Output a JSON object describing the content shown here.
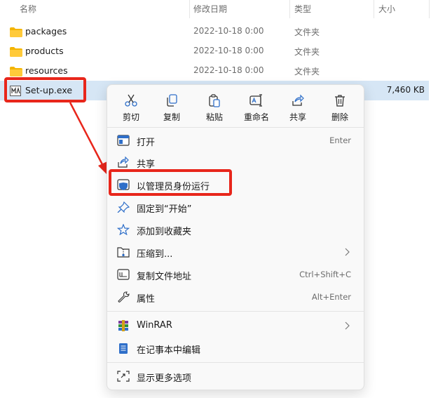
{
  "columns": {
    "name": "名称",
    "date": "修改日期",
    "type": "类型",
    "size": "大小"
  },
  "files": [
    {
      "name": "packages",
      "date": "2022-10-18 0:00",
      "type": "文件夹",
      "size": ""
    },
    {
      "name": "products",
      "date": "2022-10-18 0:00",
      "type": "文件夹",
      "size": ""
    },
    {
      "name": "resources",
      "date": "2022-10-18 0:00",
      "type": "文件夹",
      "size": ""
    },
    {
      "name": "Set-up.exe",
      "date": "",
      "type": "",
      "size": "7,460 KB"
    }
  ],
  "context_menu": {
    "quick_actions": [
      {
        "label": "剪切",
        "icon": "scissors-icon"
      },
      {
        "label": "复制",
        "icon": "copy-icon"
      },
      {
        "label": "粘贴",
        "icon": "paste-icon"
      },
      {
        "label": "重命名",
        "icon": "rename-icon"
      },
      {
        "label": "共享",
        "icon": "share-icon"
      },
      {
        "label": "删除",
        "icon": "trash-icon"
      }
    ],
    "items": [
      {
        "label": "打开",
        "shortcut": "Enter",
        "icon": "open-window-icon"
      },
      {
        "label": "共享",
        "shortcut": "",
        "icon": "share-icon"
      },
      {
        "label": "以管理员身份运行",
        "shortcut": "",
        "icon": "shield-icon"
      },
      {
        "label": "固定到“开始”",
        "shortcut": "",
        "icon": "pin-icon"
      },
      {
        "label": "添加到收藏夹",
        "shortcut": "",
        "icon": "star-icon"
      },
      {
        "label": "压缩到...",
        "shortcut": "",
        "icon": "zip-folder-icon"
      },
      {
        "label": "复制文件地址",
        "shortcut": "Ctrl+Shift+C",
        "icon": "copy-path-icon"
      },
      {
        "label": "属性",
        "shortcut": "Alt+Enter",
        "icon": "wrench-icon"
      },
      {
        "label": "WinRAR",
        "shortcut": "",
        "icon": "winrar-icon"
      },
      {
        "label": "在记事本中编辑",
        "shortcut": "",
        "icon": "notepad-icon"
      },
      {
        "label": "显示更多选项",
        "shortcut": "",
        "icon": "more-options-icon"
      }
    ]
  },
  "colors": {
    "annotation_red": "#e8261b",
    "selection": "#d6e6f5",
    "accent": "#2f6fc9"
  }
}
